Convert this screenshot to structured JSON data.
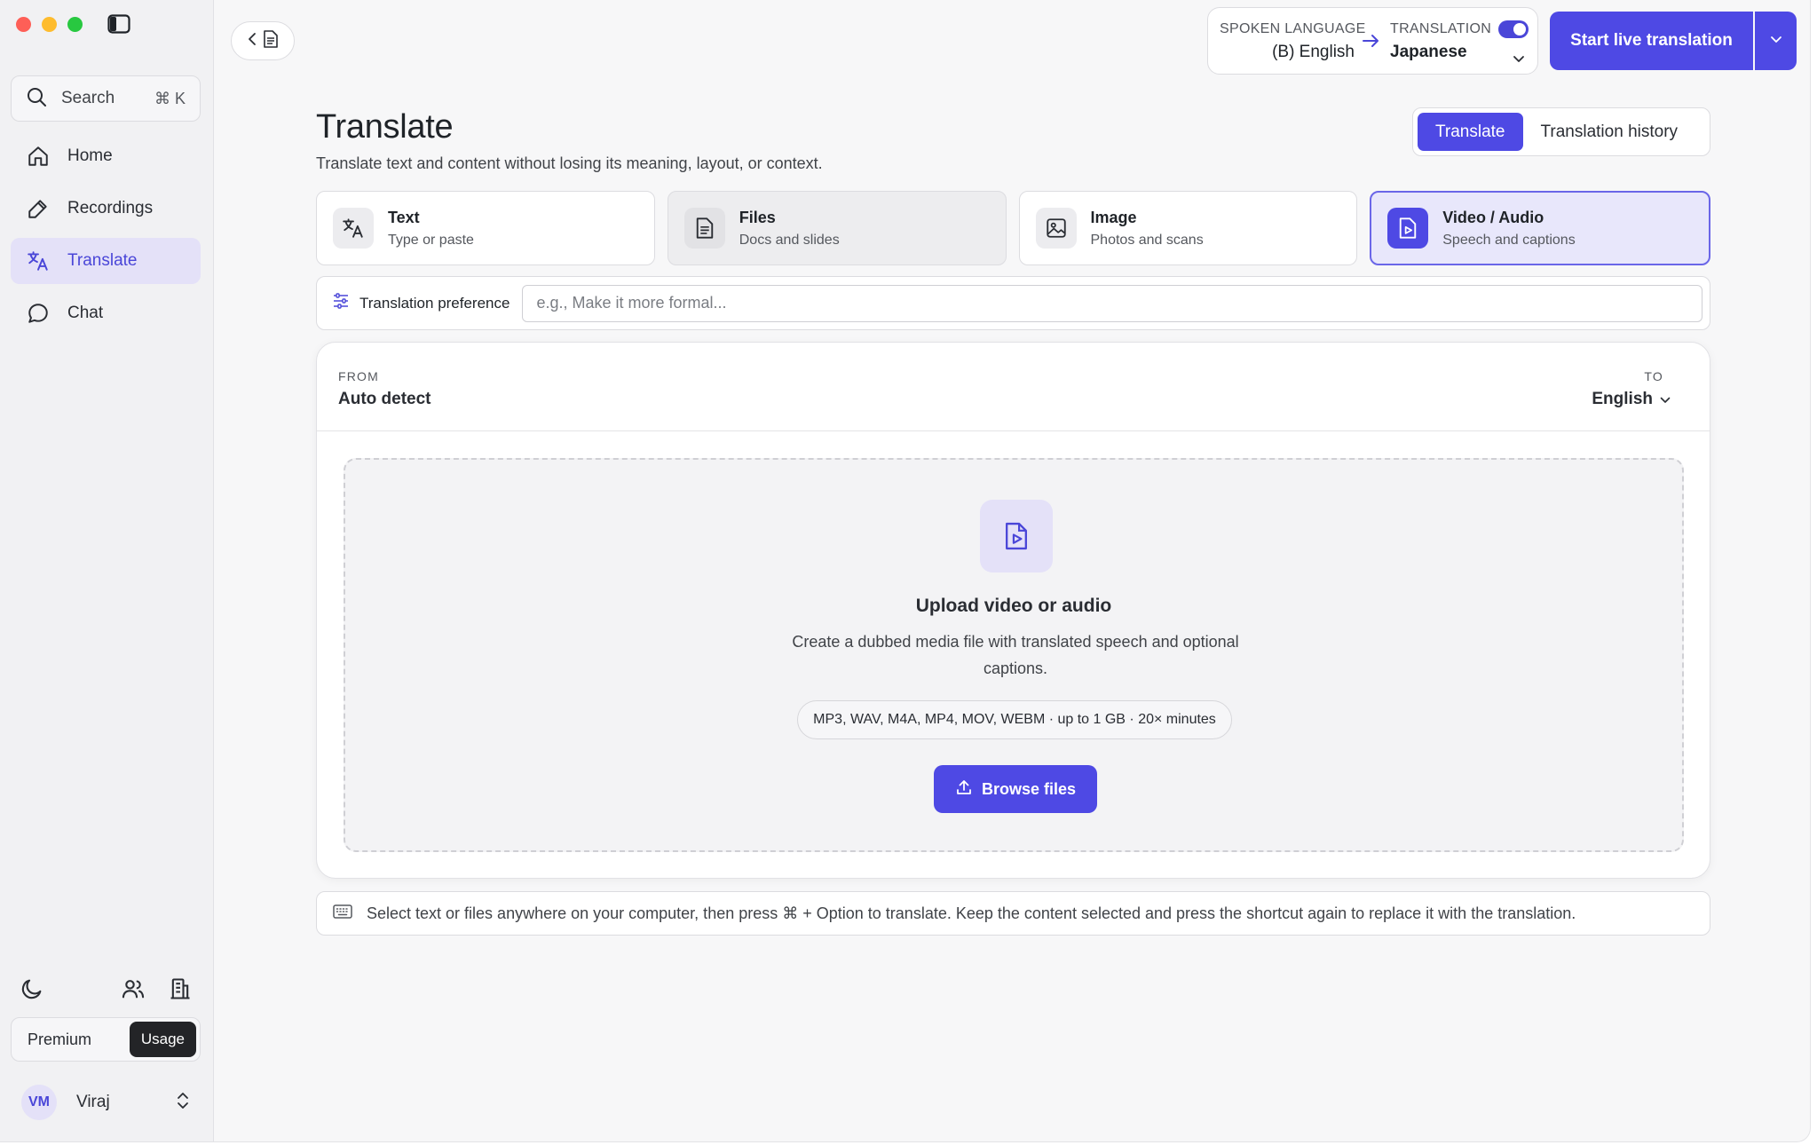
{
  "window": {
    "colors": {
      "accent": "#4e49e4",
      "accent_soft": "#e4e1f8",
      "close": "#fe5f57",
      "minimize": "#febc2e",
      "zoom": "#28c840"
    }
  },
  "sidebar": {
    "search_label": "Search",
    "search_shortcut": "⌘ K",
    "items": [
      {
        "label": "Home",
        "icon": "home-icon",
        "active": false
      },
      {
        "label": "Recordings",
        "icon": "pen-icon",
        "active": false
      },
      {
        "label": "Translate",
        "icon": "translate-icon",
        "active": true
      },
      {
        "label": "Chat",
        "icon": "chat-bubble-icon",
        "active": false
      }
    ],
    "bottom_icons": [
      "moon-icon",
      "users-icon",
      "building-icon"
    ],
    "plan_label": "Premium",
    "usage_label": "Usage",
    "user_initials": "VM",
    "user_name": "Viraj"
  },
  "topbar": {
    "spoken_language_label": "SPOKEN LANGUAGE",
    "spoken_language_value": "(B) English",
    "translation_label": "TRANSLATION",
    "translation_value": "Japanese",
    "translation_enabled": true,
    "live_button_label": "Start live translation"
  },
  "main": {
    "title": "Translate",
    "subtitle": "Translate text and content without losing its meaning, layout, or context.",
    "segments": [
      {
        "label": "Translate",
        "active": true
      },
      {
        "label": "Translation history",
        "active": false
      }
    ],
    "modes": [
      {
        "title": "Text",
        "subtitle": "Type or paste",
        "icon": "translate-icon"
      },
      {
        "title": "Files",
        "subtitle": "Docs and slides",
        "icon": "document-icon"
      },
      {
        "title": "Image",
        "subtitle": "Photos and scans",
        "icon": "image-icon"
      },
      {
        "title": "Video / Audio",
        "subtitle": "Speech and captions",
        "icon": "video-file-icon",
        "selected": true
      }
    ],
    "preference_label": "Translation preference",
    "preference_placeholder": "e.g., Make it more formal...",
    "preference_value": "",
    "from_label": "FROM",
    "from_value": "Auto detect",
    "to_label": "TO",
    "to_value": "English",
    "upload_title": "Upload video or audio",
    "upload_description": "Create a dubbed media file with translated speech and optional captions.",
    "upload_formats": "MP3, WAV, M4A, MP4, MOV, WEBM · up to 1 GB · 20× minutes",
    "browse_label": "Browse files",
    "hint_text": "Select text or files anywhere on your computer, then press ⌘ + Option to translate. Keep the content selected and press the shortcut again to replace it with the translation."
  }
}
